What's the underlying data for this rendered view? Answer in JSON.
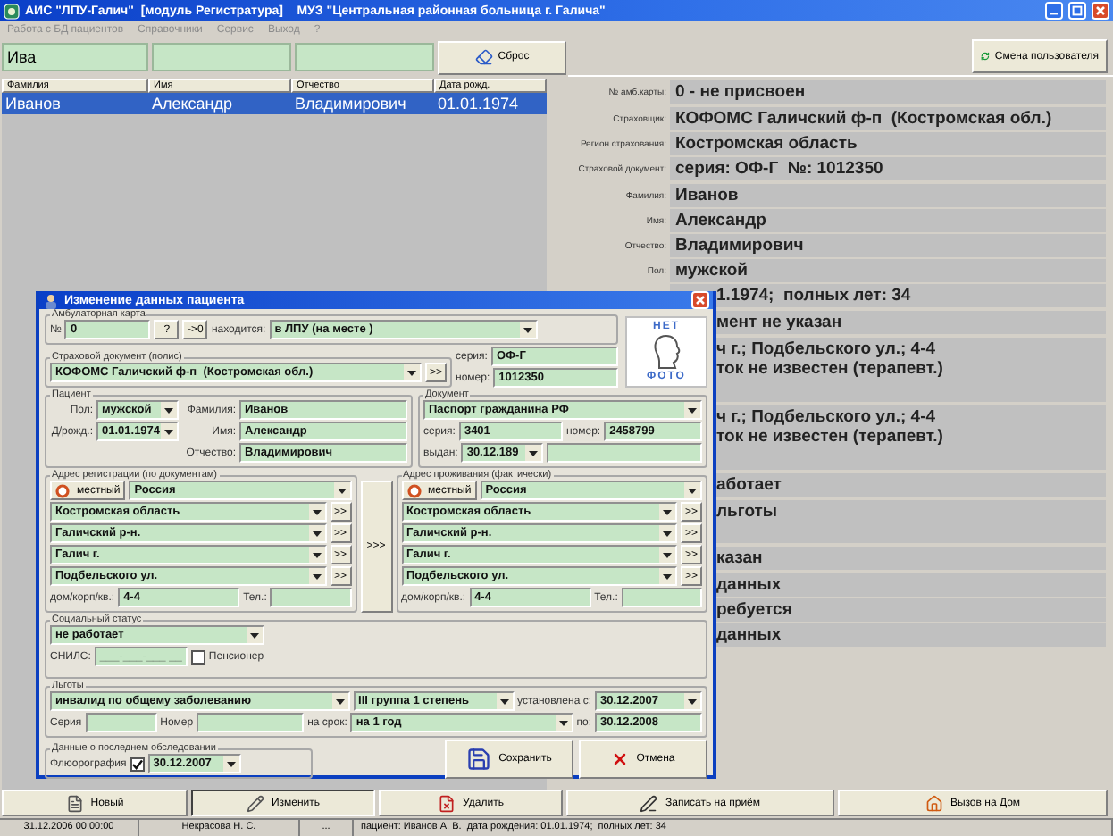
{
  "window": {
    "title": "АИС \"ЛПУ-Галич\"  [модуль Регистратура]    МУЗ \"Центральная районная больница г. Галича\"",
    "menu": [
      "Работа с БД пациентов",
      "Справочники",
      "Сервис",
      "Выход",
      "?"
    ]
  },
  "search": {
    "value": "Ива",
    "reset_button": "Сброс"
  },
  "user_button": "Смена пользователя",
  "patients_table": {
    "columns": [
      "Фамилия",
      "Имя",
      "Отчество",
      "Дата рожд."
    ],
    "rows": [
      {
        "cells": [
          "Иванов",
          "Александр",
          "Владимирович",
          "01.01.1974"
        ],
        "selected": true
      }
    ]
  },
  "info_panel": {
    "sections": [
      [
        {
          "label": "№ амб.карты:",
          "value": "0 - не присвоен"
        }
      ],
      [
        {
          "label": "Страховщик:",
          "value": "КОФОМС Галичский ф-п  (Костромская обл.)"
        },
        {
          "label": "Регион страхования:",
          "value": "Костромская область"
        },
        {
          "label": "Страховой документ:",
          "value": "серия: ОФ-Г  №: 1012350"
        }
      ],
      [
        {
          "label": "Фамилия:",
          "value": "Иванов"
        },
        {
          "label": "Имя:",
          "value": "Александр"
        },
        {
          "label": "Отчество:",
          "value": "Владимирович"
        },
        {
          "label": "Пол:",
          "value": "мужской"
        },
        {
          "value": "1.1974;  полных лет: 34"
        }
      ],
      [
        {
          "value": "мент не указан"
        }
      ],
      [
        {
          "lines": [
            "ч г.; Подбельского ул.; 4-4",
            "ток не известен (терапевт.)"
          ]
        }
      ],
      [
        {
          "lines": [
            "ч г.; Подбельского ул.; 4-4",
            "ток не известен (терапевт.)"
          ]
        }
      ],
      [
        {
          "value": "аботает"
        }
      ],
      [
        {
          "lines": [
            "льготы"
          ]
        }
      ],
      [
        {
          "value": "казан"
        }
      ],
      [
        {
          "value": "данных"
        },
        {
          "value": "ребуется"
        },
        {
          "value": "данных"
        }
      ]
    ]
  },
  "dialog": {
    "title": "Изменение данных пациента",
    "card": {
      "legend": "Амбулаторная карта",
      "number_label": "№",
      "number": "0",
      "query_button": "?",
      "zero_button": "->0",
      "location_label": "находится:",
      "location": "в ЛПУ (на месте )"
    },
    "insurance": {
      "legend": "Страховой документ (полис)",
      "insurer": "КОФОМС Галичский ф-п  (Костромская обл.)",
      "more_button": ">>",
      "series_label": "серия:",
      "series": "ОФ-Г",
      "number_label": "номер:",
      "number": "1012350"
    },
    "photo": {
      "top": "НЕТ",
      "bottom": "ФОТО"
    },
    "patient": {
      "legend": "Пациент",
      "sex_label": "Пол:",
      "sex": "мужской",
      "birth_label": "Д/рожд.:",
      "birth": "01.01.1974",
      "surname_label": "Фамилия:",
      "surname": "Иванов",
      "name_label": "Имя:",
      "name": "Александр",
      "patronymic_label": "Отчество:",
      "patronymic": "Владимирович"
    },
    "document": {
      "legend": "Документ",
      "type": "Паспорт гражданина РФ",
      "series_label": "серия:",
      "series": "3401",
      "number_label": "номер:",
      "number": "2458799",
      "issued_label": "выдан:",
      "issued": "30.12.189"
    },
    "addresses": [
      {
        "legend": "Адрес регистрации (по документам)",
        "local_button": "местный",
        "country": "Россия",
        "levels": [
          "Костромская область",
          "Галичский р-н.",
          "Галич г.",
          "Подбельского ул."
        ],
        "more_button": ">>",
        "house_label": "дом/корп/кв.:",
        "house": "4-4",
        "phone_label": "Тел.:"
      },
      {
        "legend": "Адрес проживания (фактически)",
        "local_button": "местный",
        "country": "Россия",
        "levels": [
          "Костромская область",
          "Галичский р-н.",
          "Галич г.",
          "Подбельского ул."
        ],
        "more_button": ">>",
        "house_label": "дом/корп/кв.:",
        "house": "4-4",
        "phone_label": "Тел.:"
      }
    ],
    "copy_button": ">>>",
    "social": {
      "legend": "Социальный статус",
      "status": "не работает",
      "snils_label": "СНИЛС:",
      "snils": "___-___-___ __",
      "pensioner_label": "Пенсионер",
      "pensioner": false
    },
    "benefits": {
      "legend": "Льготы",
      "benefit": "инвалид по общему заболеванию",
      "group": "III группа 1 степень",
      "from_label": "установлена с:",
      "from": "30.12.2007",
      "series_label": "Серия",
      "number_label": "Номер",
      "term_label": "на срок:",
      "term": "на 1 год",
      "to_label": "по:",
      "to": "30.12.2008"
    },
    "exam": {
      "legend": "Данные о последнем обследовании",
      "fluoro_label": "Флюорография",
      "fluoro": true,
      "date": "30.12.2007"
    },
    "buttons": [
      {
        "label": "Сохранить",
        "kind": "save"
      },
      {
        "label": "Отмена",
        "kind": "cancel"
      }
    ]
  },
  "toolbar": [
    {
      "label": "Новый",
      "kind": "new",
      "pressed": false
    },
    {
      "label": "Изменить",
      "kind": "edit",
      "pressed": true
    },
    {
      "label": "Удалить",
      "kind": "delete",
      "pressed": false
    },
    {
      "label": "Записать на приём",
      "kind": "appoint",
      "pressed": false
    },
    {
      "label": "Вызов на Дом",
      "kind": "home",
      "pressed": false
    }
  ],
  "status_bar": [
    "31.12.2006 00:00:00",
    "Некрасова Н. С.",
    "...",
    "пациент: Иванов А. В.  дата рождения: 01.01.1974;  полных лет: 34"
  ]
}
